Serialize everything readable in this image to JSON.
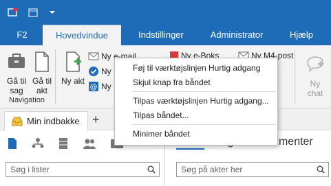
{
  "titlebar": {
    "qa_icons": [
      "notification-icon",
      "calendar-icon",
      "dropdown-arrow-icon"
    ]
  },
  "tabs": [
    {
      "label": "F2"
    },
    {
      "label": "Hovedvindue"
    },
    {
      "label": "Indstillinger"
    },
    {
      "label": "Administrator"
    },
    {
      "label": "Hjælp"
    }
  ],
  "ribbon": {
    "goto_case": "Gå til sag",
    "goto_act": "Gå til akt",
    "navigation_group": "Navigation",
    "new_act": "Ny akt",
    "small_items": [
      "Ny e-mail",
      "Ny",
      "Ny"
    ],
    "chip_box": "Ny e-Boks",
    "chip_m4": "Ny M4-post",
    "new_chat": "Ny chat"
  },
  "context_menu": {
    "items": [
      "Føj til værktøjslinjen Hurtig adgang",
      "Skjul knap fra båndet",
      "Tilpas værktøjslinjen Hurtig adgang...",
      "Tilpas båndet...",
      "Minimer båndet"
    ]
  },
  "panel": {
    "tab_label": "Min indbakke",
    "search_lists_placeholder": "Søg i lister",
    "right_tabs": [
      "Akter",
      "Sager",
      "Dokumenter"
    ],
    "search_acts_placeholder": "Søg på akter her"
  },
  "colors": {
    "brand": "#1e6bb8",
    "ribbon_bg": "#f3f3f3"
  }
}
